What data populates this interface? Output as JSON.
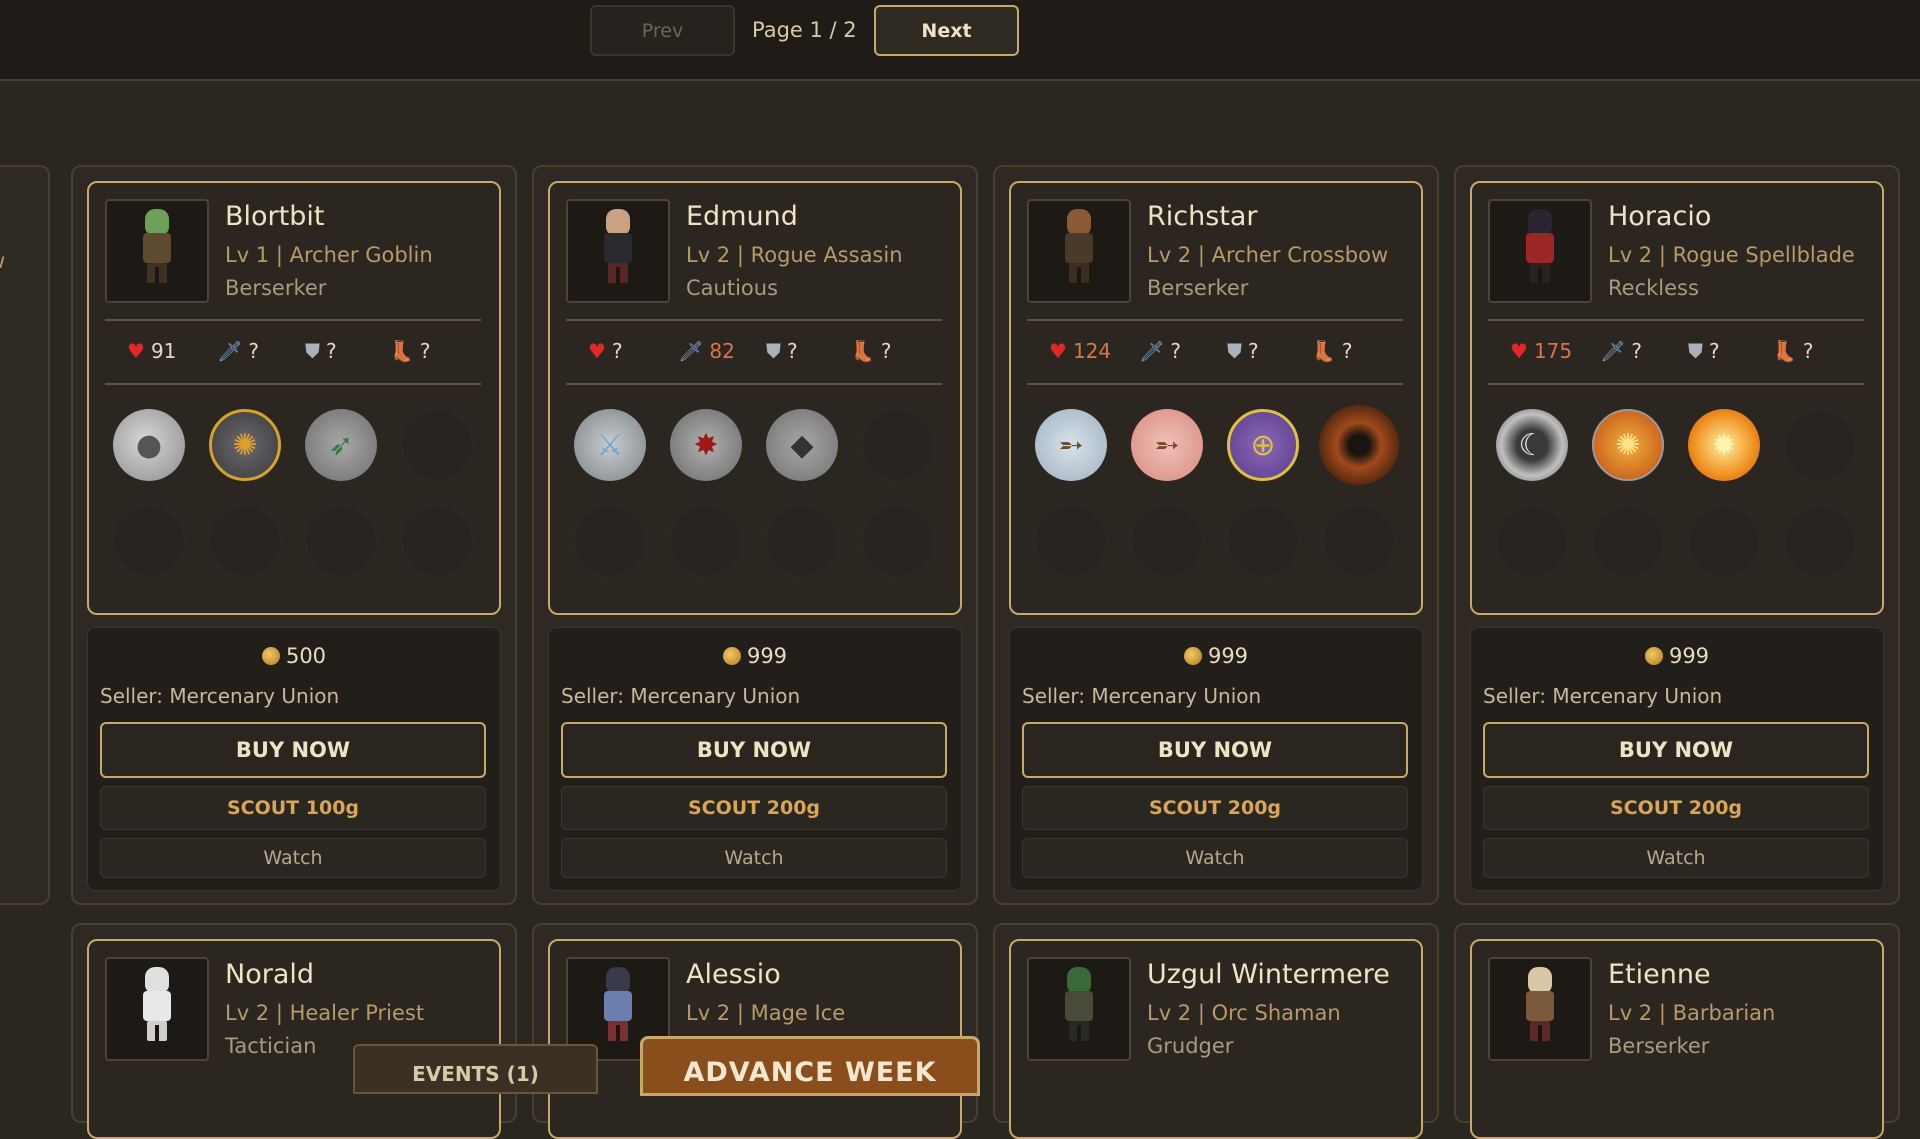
{
  "pagination": {
    "prev": "Prev",
    "next": "Next",
    "page": "Page 1 / 2"
  },
  "mercenaries": [
    {
      "name": "Blortbit",
      "level": "Lv 1 | Archer Goblin",
      "trait": "Berserker",
      "stats": {
        "hp": "91",
        "atk": "?",
        "def": "?",
        "spd": "?"
      },
      "price": "500",
      "seller": "Seller: Mercenary Union",
      "buy": "BUY NOW",
      "scout": "SCOUT 100g",
      "watch": "Watch",
      "skills": [
        "comet-skill-icon",
        "beast-skill-icon",
        "arrow-skill-icon"
      ],
      "colors": {
        "head": "#6fa05a",
        "body": "#5e4a30",
        "legs": "#3e3323"
      }
    },
    {
      "name": "Edmund",
      "level": "Lv 2 | Rogue Assasin",
      "trait": "Cautious",
      "stats": {
        "hp": "?",
        "atk": "82",
        "def": "?",
        "spd": "?"
      },
      "price": "999",
      "seller": "Seller: Mercenary Union",
      "buy": "BUY NOW",
      "scout": "SCOUT 200g",
      "watch": "Watch",
      "skills": [
        "blade-skill-icon",
        "bleed-skill-icon",
        "dagger-skill-icon"
      ],
      "colors": {
        "head": "#c9a183",
        "body": "#2a2a2e",
        "legs": "#5a2525"
      }
    },
    {
      "name": "Richstar",
      "level": "Lv 2 | Archer Crossbow",
      "trait": "Berserker",
      "stats": {
        "hp": "124",
        "atk": "?",
        "def": "?",
        "spd": "?"
      },
      "price": "999",
      "seller": "Seller: Mercenary Union",
      "buy": "BUY NOW",
      "scout": "SCOUT 200g",
      "watch": "Watch",
      "skills": [
        "crossbow-skill-icon",
        "crossbow-volley-skill-icon",
        "crossbow-aim-skill-icon",
        "bomb-skill-icon"
      ],
      "colors": {
        "head": "#8a5a34",
        "body": "#4a3a2a",
        "legs": "#3a2e22"
      }
    },
    {
      "name": "Horacio",
      "level": "Lv 2 | Rogue Spellblade",
      "trait": "Reckless",
      "stats": {
        "hp": "175",
        "atk": "?",
        "def": "?",
        "spd": "?"
      },
      "price": "999",
      "seller": "Seller: Mercenary Union",
      "buy": "BUY NOW",
      "scout": "SCOUT 200g",
      "watch": "Watch",
      "skills": [
        "crescent-skill-icon",
        "fire-swirl-skill-icon",
        "fire-burst-skill-icon"
      ],
      "colors": {
        "head": "#2b2330",
        "body": "#9a2626",
        "legs": "#2a2222"
      }
    }
  ],
  "row2": [
    {
      "name": "Norald",
      "level": "Lv 2 | Healer Priest",
      "trait": "Tactician",
      "colors": {
        "head": "#e0e0e0",
        "body": "#e8e8e8",
        "legs": "#cfcfcf"
      }
    },
    {
      "name": "Alessio",
      "level": "Lv 2 | Mage Ice",
      "trait": "",
      "colors": {
        "head": "#3a3a4a",
        "body": "#6a7fb0",
        "legs": "#7a3030"
      }
    },
    {
      "name": "Uzgul Wintermere",
      "level": "Lv 2 | Orc Shaman",
      "trait": "Grudger",
      "colors": {
        "head": "#3a6a3a",
        "body": "#4a4a3a",
        "legs": "#2a2a22"
      }
    },
    {
      "name": "Etienne",
      "level": "Lv 2 | Barbarian",
      "trait": "Berserker",
      "colors": {
        "head": "#d8c8a8",
        "body": "#7a5a3a",
        "legs": "#5a2a2a"
      }
    }
  ],
  "partial_card": {
    "level_fragment": "w"
  },
  "bottom": {
    "events": "EVENTS (1)",
    "advance": "ADVANCE WEEK"
  }
}
